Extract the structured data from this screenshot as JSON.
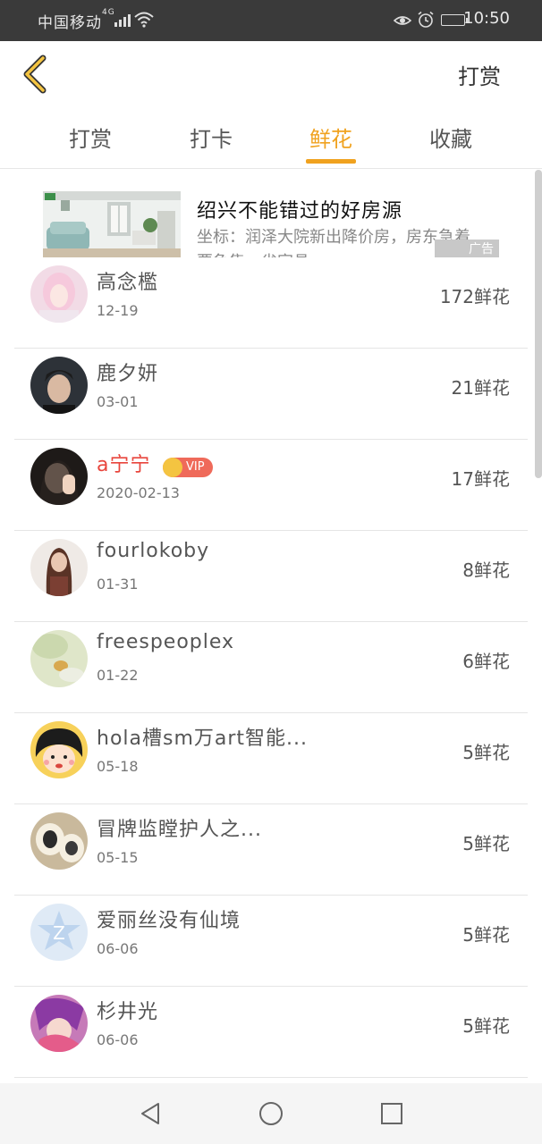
{
  "status_bar": {
    "carrier": "中国移动",
    "network": "4G",
    "time": "10:50"
  },
  "header": {
    "back_icon": "chevron-left-icon",
    "action_label": "打赏"
  },
  "tabs": [
    {
      "label": "打赏"
    },
    {
      "label": "打卡"
    },
    {
      "label": "鲜花"
    },
    {
      "label": "收藏"
    }
  ],
  "active_tab": "鲜花",
  "ad": {
    "title": "绍兴不能错过的好房源",
    "description": "坐标：润泽大院新出降价房，房东急着要急售，省家具",
    "badge": "广告"
  },
  "list": [
    {
      "name": "高念檻",
      "date": "12-19",
      "count": "172鲜花",
      "vip": false
    },
    {
      "name": "鹿夕妍",
      "date": "03-01",
      "count": "21鲜花",
      "vip": false
    },
    {
      "name": "a宁宁",
      "date": "2020-02-13",
      "count": "17鲜花",
      "vip": true,
      "vip_label": "VIP"
    },
    {
      "name": "fourlokoby",
      "date": "01-31",
      "count": "8鲜花",
      "vip": false
    },
    {
      "name": "freespeoplex",
      "date": "01-22",
      "count": "6鲜花",
      "vip": false
    },
    {
      "name": "hola槽sm万art智能...",
      "date": "05-18",
      "count": "5鲜花",
      "vip": false
    },
    {
      "name": "冒牌监瞠护人之...",
      "date": "05-15",
      "count": "5鲜花",
      "vip": false
    },
    {
      "name": "爱丽丝没有仙境",
      "date": "06-06",
      "count": "5鲜花",
      "vip": false
    },
    {
      "name": "杉井光",
      "date": "06-06",
      "count": "5鲜花",
      "vip": false
    }
  ],
  "colors": {
    "accent": "#f0a21f",
    "vip_name": "#e8453c",
    "vip_badge": "#ef6a5a",
    "status_bar": "#3a3a3a"
  }
}
